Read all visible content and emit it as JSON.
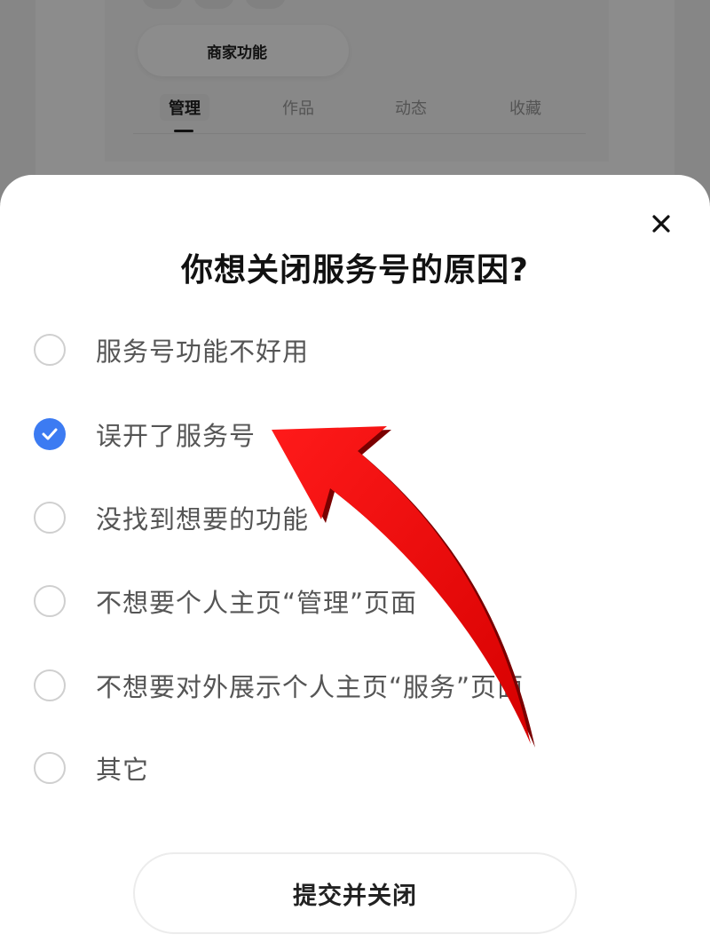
{
  "background": {
    "chips": [
      "",
      "",
      ""
    ],
    "merchant_label": "商家功能",
    "tabs": [
      "管理",
      "作品",
      "动态",
      "收藏"
    ],
    "active_tab": "管理"
  },
  "dialog": {
    "title": "你想关闭服务号的原因?",
    "close_icon": "close-icon",
    "options": [
      {
        "label": "服务号功能不好用",
        "checked": false
      },
      {
        "label": "误开了服务号",
        "checked": true
      },
      {
        "label": "没找到想要的功能",
        "checked": false
      },
      {
        "label": "不想要个人主页“管理”页面",
        "checked": false
      },
      {
        "label": "不想要对外展示个人主页“服务”页面",
        "checked": false
      },
      {
        "label": "其它",
        "checked": false
      }
    ],
    "submit_label": "提交并关闭"
  },
  "colors": {
    "accent": "#3c7bf2",
    "annotation_arrow": "#ee0a0a"
  }
}
